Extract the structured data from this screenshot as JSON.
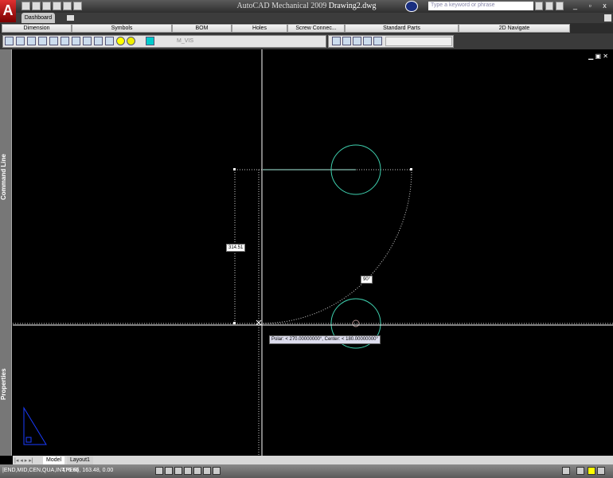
{
  "app": {
    "title_prefix": "AutoCAD Mechanical 2009",
    "document": "Drawing2.dwg",
    "logo": "A"
  },
  "search": {
    "placeholder": "Type a keyword or phrase"
  },
  "tabs": [
    {
      "label": "Dashboard"
    }
  ],
  "ribbon": [
    "Dimension",
    "Symbols",
    "BOM",
    "Holes",
    "Screw Connec...",
    "Standard Parts",
    "2D Navigate"
  ],
  "layer": {
    "name": "M_VIS"
  },
  "panels": {
    "command_line": "Command Line",
    "properties": "Properties"
  },
  "drawing": {
    "dimension_label": "314.51",
    "angle_label": "90°",
    "tooltip": "Polar: < 270.00000000°,  Center: < 180.00000000°"
  },
  "layout_tabs": [
    "Model",
    "Layout1"
  ],
  "status": {
    "snaps": "|END,MID,CEN,QUA,INT,PER|",
    "coordinates": "476.66, 163.48, 0.00"
  },
  "window_controls": "_ ▫ x",
  "colors": {
    "entity": "#3fd2b0",
    "crosshair": "#ffffff",
    "ucs": "#1a3cff"
  }
}
